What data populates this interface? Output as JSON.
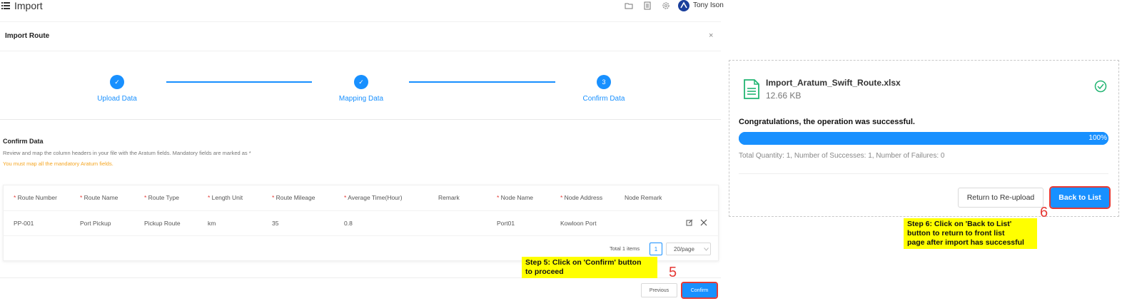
{
  "app": {
    "title": "Import",
    "user_name": "Tony Ison",
    "icons": [
      "menu-icon",
      "folder-icon",
      "document-icon",
      "settings-icon"
    ]
  },
  "modal": {
    "title": "Import Route",
    "close_glyph": "×",
    "steps": [
      {
        "label": "Upload Data",
        "state": "done",
        "glyph": "✓"
      },
      {
        "label": "Mapping Data",
        "state": "done",
        "glyph": "✓"
      },
      {
        "label": "Confirm Data",
        "state": "active",
        "glyph": "3"
      }
    ],
    "confirm_section": {
      "title": "Confirm Data",
      "description": "Review and map the column headers in your file with the Aratum fields. Mandatory fields are marked as *",
      "warning": "You must map all the mandatory Aratum fields."
    },
    "table": {
      "columns": [
        {
          "label": "Route Number",
          "required": true
        },
        {
          "label": "Route Name",
          "required": true
        },
        {
          "label": "Route Type",
          "required": true
        },
        {
          "label": "Length Unit",
          "required": true
        },
        {
          "label": "Route Mileage",
          "required": true
        },
        {
          "label": "Average Time(Hour)",
          "required": true
        },
        {
          "label": "Remark",
          "required": false
        },
        {
          "label": "Node Name",
          "required": true
        },
        {
          "label": "Node Address",
          "required": true
        },
        {
          "label": "Node Remark",
          "required": false
        }
      ],
      "rows": [
        [
          "PP-001",
          "Port Pickup",
          "Pickup Route",
          "km",
          "35",
          "0.8",
          "",
          "Port01",
          "Kowloon Port",
          ""
        ]
      ],
      "pager": {
        "total": "Total 1 items",
        "page": "1",
        "page_size": "20/page"
      }
    },
    "buttons": {
      "previous": "Previous",
      "confirm": "Confirm"
    }
  },
  "annotations": {
    "step5": {
      "text_line1": "Step 5: Click on 'Confirm' button",
      "text_line2": "to proceed",
      "number": "5"
    },
    "step6": {
      "text_line1": "Step 6: Click on 'Back to List'",
      "text_line2": "button to return to front list",
      "text_line3": "page after import has successful",
      "number": "6"
    }
  },
  "result_panel": {
    "file_name": "Import_Aratum_Swift_Route.xlsx",
    "file_size": "12.66 KB",
    "message": "Congratulations, the operation was successful.",
    "progress": 1.0,
    "progress_label": "100%",
    "stats": "Total Quantity: 1, Number of Successes: 1, Number of Failures: 0",
    "buttons": {
      "reupload": "Return to Re-upload",
      "back": "Back to List"
    }
  },
  "colors": {
    "primary": "#1890ff",
    "highlight": "#ffff00",
    "annotation_red": "#e53935",
    "warning": "#f5a623",
    "success": "#22b573"
  }
}
